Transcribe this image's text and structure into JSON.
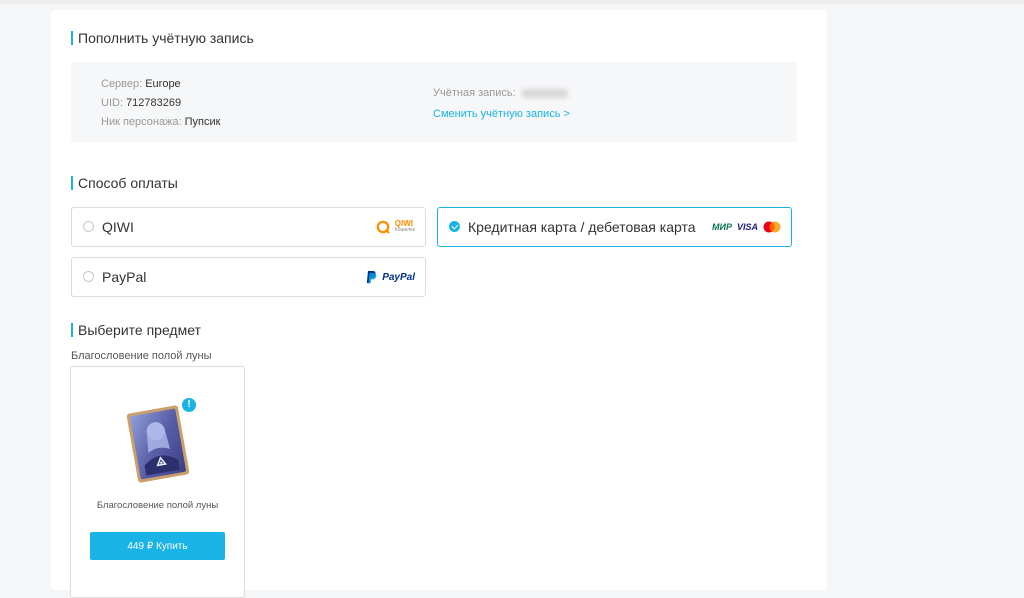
{
  "account": {
    "title": "Пополнить учётную запись",
    "server_label": "Сервер:",
    "server_value": "Europe",
    "uid_label": "UID:",
    "uid_value": "712783269",
    "nick_label": "Ник персонажа:",
    "nick_value": "Пупсик",
    "account_label": "Учётная запись:",
    "switch_link": "Сменить учётную запись >"
  },
  "payment": {
    "title": "Способ оплаты",
    "options": [
      {
        "label": "QIWI",
        "logo": "qiwi-logo",
        "selected": false
      },
      {
        "label": "Кредитная карта / дебетовая карта",
        "logo": "card-logos",
        "selected": true
      },
      {
        "label": "PayPal",
        "logo": "paypal-logo",
        "selected": false
      }
    ],
    "qiwi_logo_text": "QIWI",
    "qiwi_logo_sub": "Кошелек",
    "mir_text": "МИР",
    "visa_text": "VISA",
    "paypal_text": "PayPal"
  },
  "items": {
    "title": "Выберите предмет",
    "category": "Благословение полой луны",
    "list": [
      {
        "name": "Благословение полой луны",
        "buy_label": "449 ₽ Купить",
        "badge": "!"
      }
    ]
  },
  "colors": {
    "accent": "#1ab3e6",
    "mir_green": "#0f754e",
    "visa_blue": "#1a1f71",
    "paypal_dark": "#003087",
    "paypal_light": "#009cde",
    "qiwi_orange": "#ff8c00"
  }
}
